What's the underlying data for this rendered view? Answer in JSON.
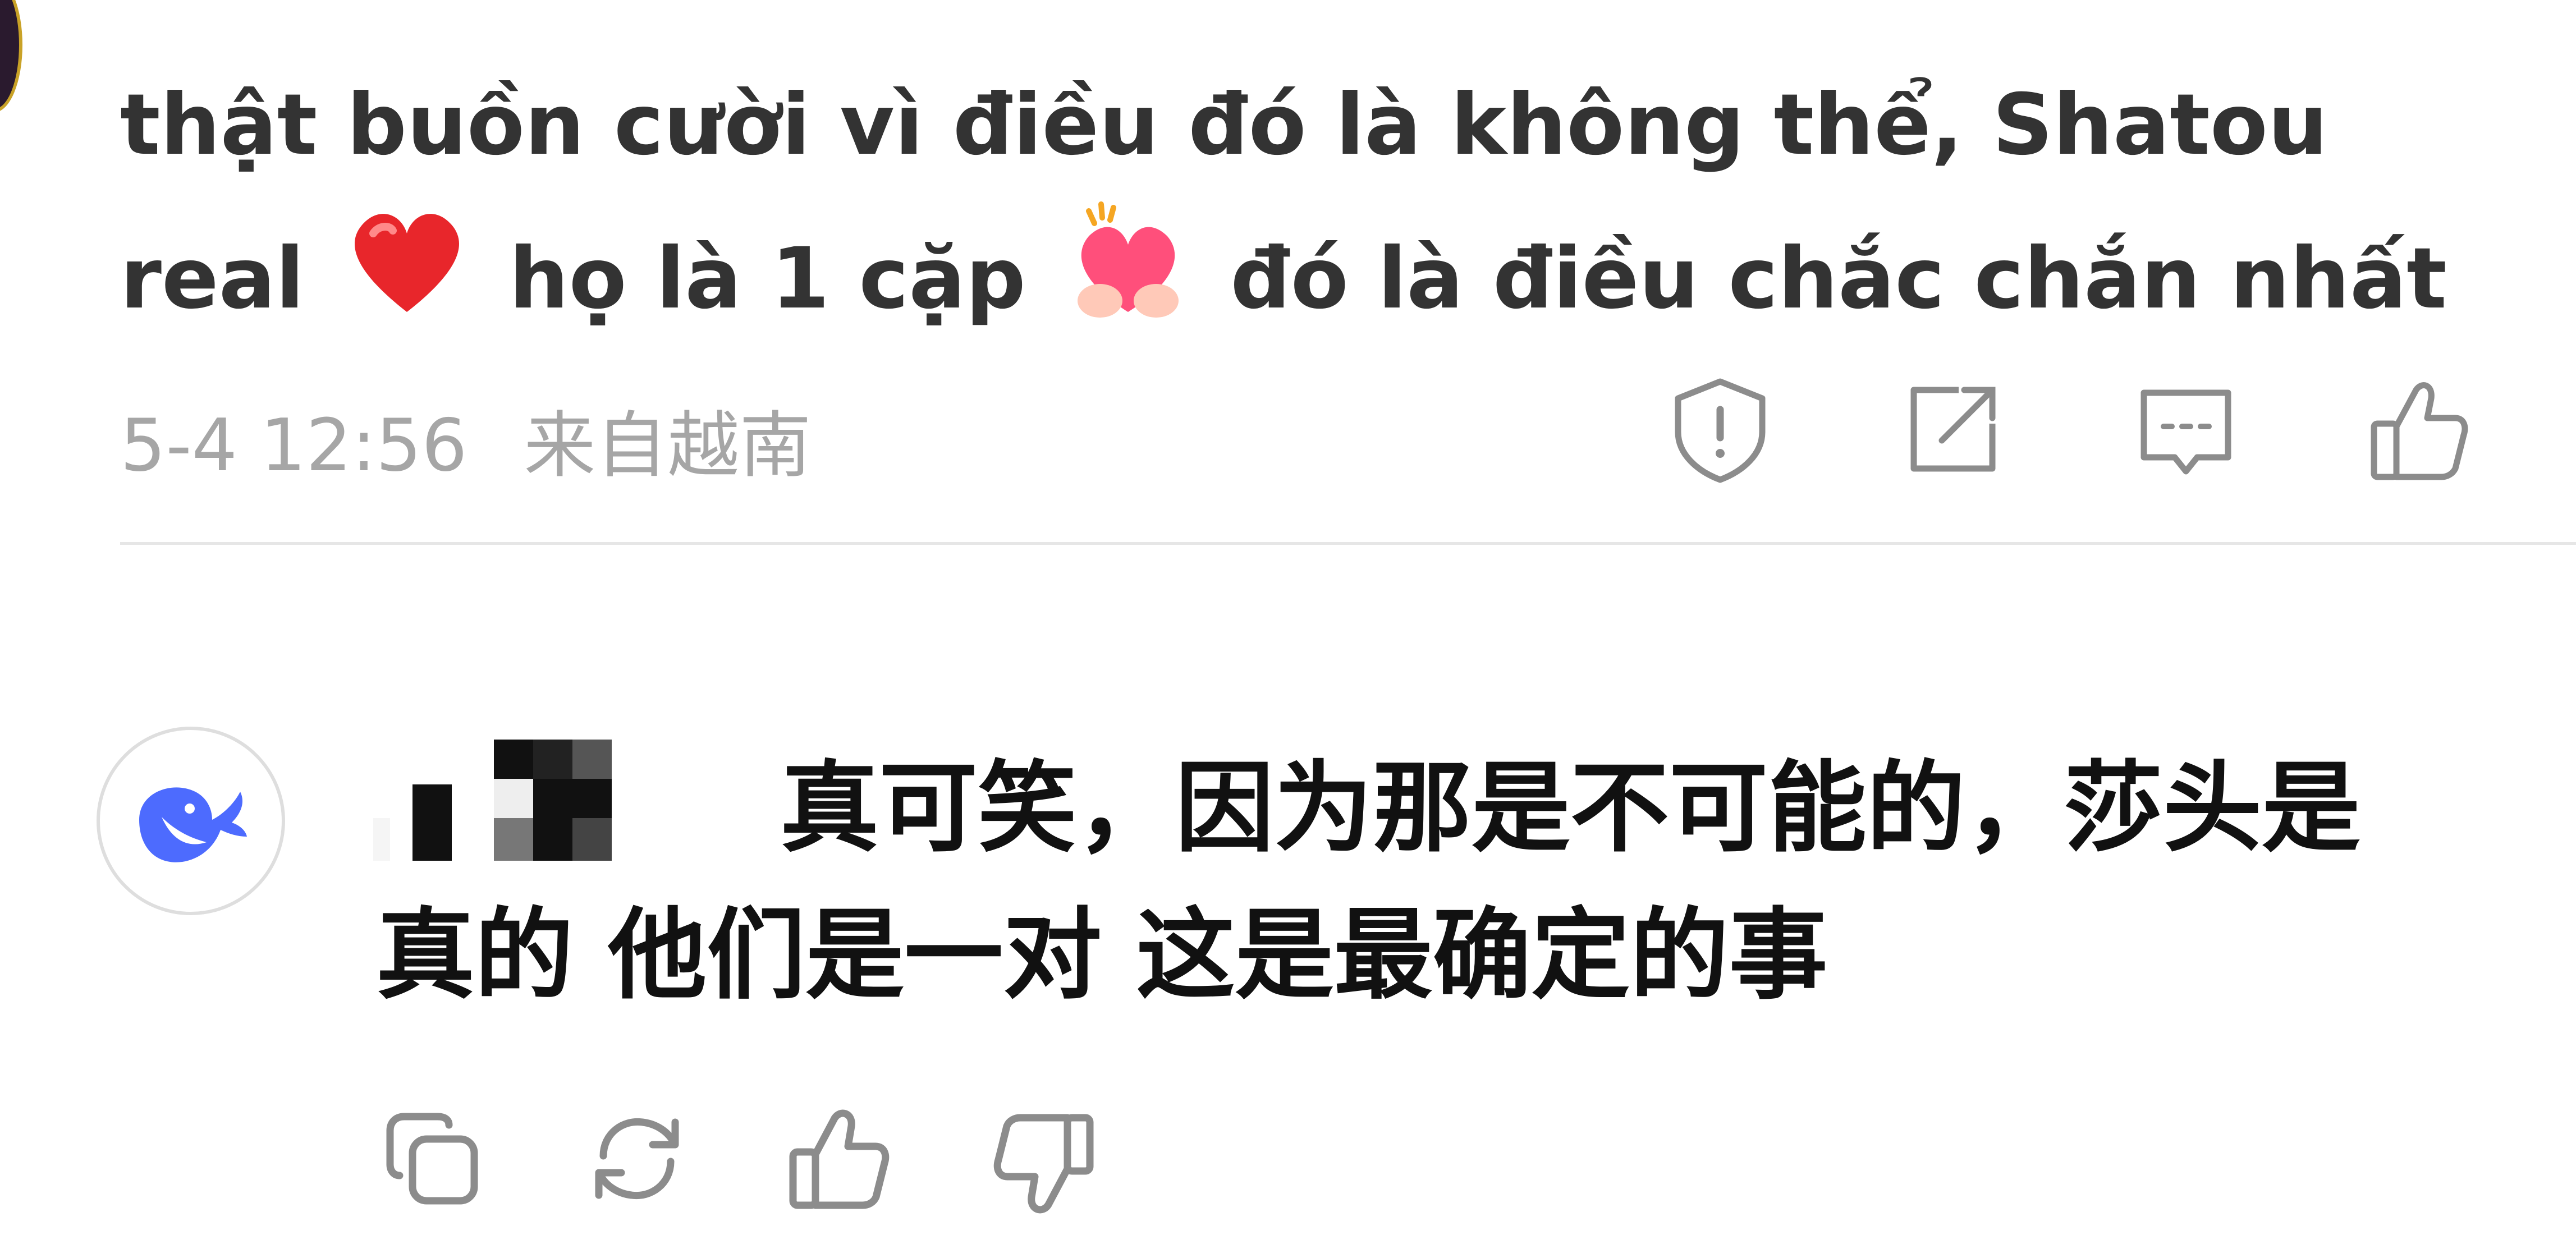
{
  "comment": {
    "text_part1": "thật buồn cười vì điều đó là không thể, Shatou",
    "text_part2": "real",
    "text_part3": "họ là 1 cặp",
    "text_part4": "đó là điều chắc chắn nhất",
    "emoji_1": "red-heart",
    "emoji_2": "heart-hands",
    "date": "5-4 12:56",
    "location": "来自越南",
    "actions": [
      "report-icon",
      "share-icon",
      "comment-icon",
      "like-icon"
    ]
  },
  "reply": {
    "text": "真可笑，因为那是不可能的，莎头是真的 他们是一对 这是最确定的事",
    "line1": "真可笑，因为那是不可能的，莎头是",
    "line2": "真的 他们是一对 这是最确定的事",
    "actions": [
      "copy-icon",
      "regenerate-icon",
      "thumbs-up-icon",
      "thumbs-down-icon"
    ]
  },
  "colors": {
    "text": "#333333",
    "muted": "#a6a6a6",
    "icon": "#8c8c8c",
    "brand": "#4d6bfe",
    "divider": "#e6e6e6"
  }
}
